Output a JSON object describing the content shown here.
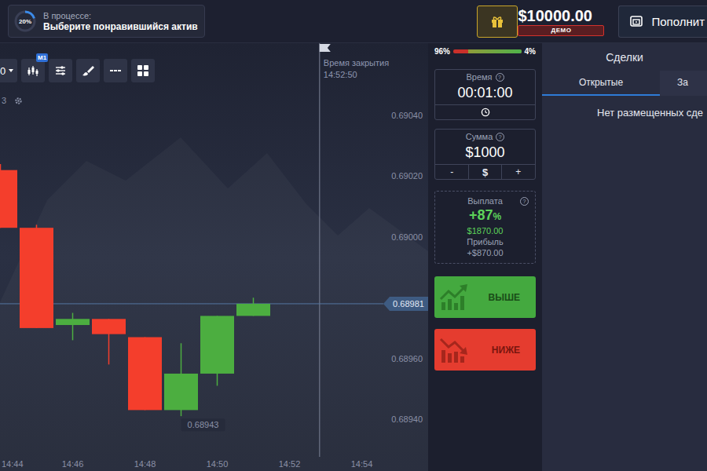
{
  "header": {
    "task": {
      "progress": "20%",
      "level": 0.2,
      "title": "В процессе:",
      "subtitle": "Выберите понравившийся актив"
    },
    "balance": {
      "amount": "$10000.00",
      "badge": "ДЕМО"
    },
    "deposit_button": "Пополнит"
  },
  "chart": {
    "toolbar": {
      "timeframe": "0",
      "badge": "M1"
    },
    "indicator_label": "3",
    "close_time": {
      "label": "Время закрытия",
      "time": "14:52:50"
    },
    "price_ticks": [
      "0.69040",
      "0.69020",
      "0.69000",
      "0.68960",
      "0.68940"
    ],
    "time_ticks": [
      "14:44",
      "14:46",
      "14:48",
      "14:50",
      "14:52",
      "14:54"
    ],
    "current_price": {
      "label": "0.68981",
      "value": 0.68978
    },
    "low_marker": {
      "label": "0.68943",
      "candle": 5
    },
    "candles": [
      {
        "open": 0.69022,
        "close": 0.69003,
        "high": 0.69024,
        "low": 0.69003
      },
      {
        "open": 0.69003,
        "close": 0.6897,
        "high": 0.69004,
        "low": 0.6897
      },
      {
        "open": 0.68971,
        "close": 0.68973,
        "high": 0.68975,
        "low": 0.68966
      },
      {
        "open": 0.68973,
        "close": 0.68968,
        "high": 0.68973,
        "low": 0.68958
      },
      {
        "open": 0.68967,
        "close": 0.68943,
        "high": 0.68967,
        "low": 0.68943
      },
      {
        "open": 0.68943,
        "close": 0.68955,
        "high": 0.68965,
        "low": 0.68941
      },
      {
        "open": 0.68955,
        "close": 0.68974,
        "high": 0.68974,
        "low": 0.68951
      },
      {
        "open": 0.68974,
        "close": 0.68978,
        "high": 0.6898,
        "low": 0.68974
      }
    ]
  },
  "trade": {
    "sentiment": {
      "up": "96%",
      "down": "4%",
      "level": 0.78
    },
    "time": {
      "label": "Время",
      "info": "?",
      "value": "00:01:00"
    },
    "amount": {
      "label": "Сумма",
      "info": "?",
      "value": "$1000",
      "buttons": [
        "-",
        "$",
        "+"
      ]
    },
    "payout": {
      "label": "Выплата",
      "info": "?",
      "percent_value": "+87",
      "percent_sign": "%",
      "total": "$1870.00",
      "profit_label": "Прибыль",
      "profit": "+$870.00"
    },
    "buttons": [
      {
        "label": "ВЫШЕ",
        "kind": "up"
      },
      {
        "label": "НИЖЕ",
        "kind": "down"
      }
    ]
  },
  "deals": {
    "title": "Сделки",
    "tabs": [
      {
        "label": "Открытые",
        "selected": true
      },
      {
        "label": "За",
        "selected": false
      }
    ],
    "empty": "Нет размещенных сде"
  }
}
